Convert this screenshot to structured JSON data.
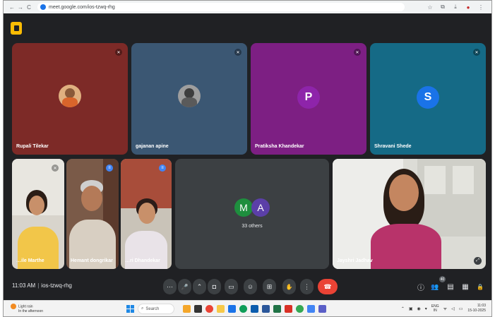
{
  "browser": {
    "url": "meet.google.com/ios-tzwq-rhg",
    "nav_back": "←",
    "nav_forward": "→",
    "nav_reload": "C",
    "star": "☆",
    "ext": "⧉",
    "download": "⤓",
    "profile": "●",
    "menu": "⋮"
  },
  "participants": [
    {
      "name": "Rupali Tilekar",
      "bg": "#7d2a27",
      "type": "photo-avatar",
      "mic": "muted"
    },
    {
      "name": "gajanan apine",
      "bg": "#3b5773",
      "type": "photo-avatar",
      "mic": "muted"
    },
    {
      "name": "Pratiksha Khandekar",
      "bg": "#7d1f83",
      "type": "letter",
      "letter": "P",
      "avatar_color": "#8e24aa",
      "mic": "muted"
    },
    {
      "name": "Shravani Shede",
      "bg": "#156a86",
      "type": "letter",
      "letter": "S",
      "avatar_color": "#1a73e8",
      "mic": "muted"
    },
    {
      "name": "…ile Marthe",
      "type": "camera",
      "mic": "muted"
    },
    {
      "name": "Hemant dongrikar",
      "type": "camera",
      "mic": "active"
    },
    {
      "name": "…ri Dhandekar",
      "type": "camera",
      "mic": "active"
    },
    {
      "name": "Jayshri Jadhav",
      "type": "camera",
      "mic": "none"
    }
  ],
  "others": {
    "avatars": [
      {
        "letter": "M",
        "color": "#1e8e3e"
      },
      {
        "letter": "A",
        "color": "#5b3fa8"
      }
    ],
    "label": "33 others"
  },
  "meeting": {
    "time": "11:03 AM",
    "separator": "|",
    "code": "ios-tzwq-rhg"
  },
  "controls": {
    "more": "⋯",
    "mic": "🎤",
    "cam_more": "⌃",
    "camera": "◘",
    "captions": "▭",
    "emoji": "☺",
    "present": "⊞",
    "hand": "✋",
    "options": "⋮",
    "end": "☎"
  },
  "right_controls": {
    "info": "ⓘ",
    "people": "👥",
    "people_count": "40",
    "chat": "▤",
    "activities": "▦",
    "lock": "🔒"
  },
  "taskbar": {
    "weather_line1": "Light rain",
    "weather_line2": "In the afternoon",
    "search_placeholder": "Search",
    "lang": "ENG",
    "lang2": "IN",
    "time": "11:03",
    "date": "15-10-2025"
  }
}
